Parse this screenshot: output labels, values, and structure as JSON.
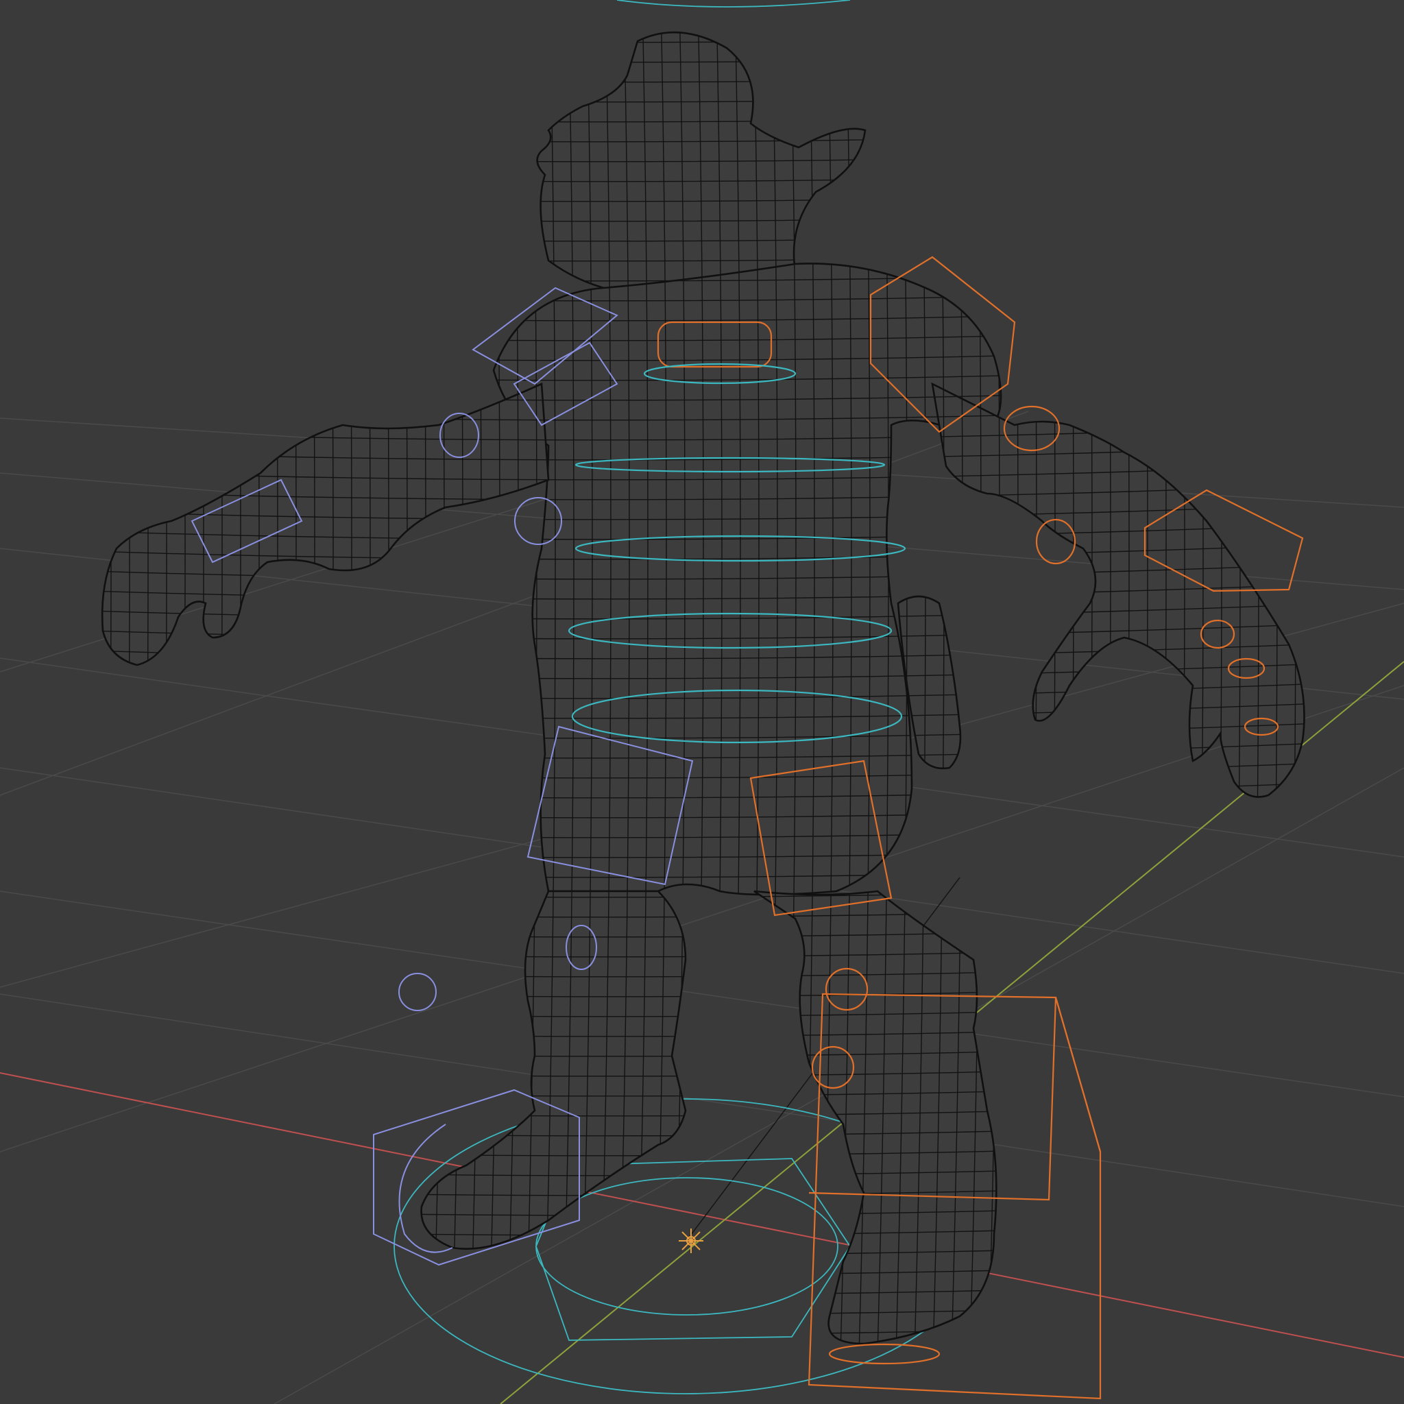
{
  "viewport": {
    "background": "#3a3a3a",
    "grid_color": "#4a4a4a",
    "x_axis_color": "#c05050",
    "y_axis_color": "#8ea23c",
    "mesh_wire_color": "#121212"
  },
  "rig": {
    "selected_color": "#e0702a",
    "deselected_color": "#8a90e0",
    "spine_color": "#3cb8c0"
  },
  "origin": {
    "icon": "crosshair-origin-icon",
    "color": "#e8a040"
  }
}
